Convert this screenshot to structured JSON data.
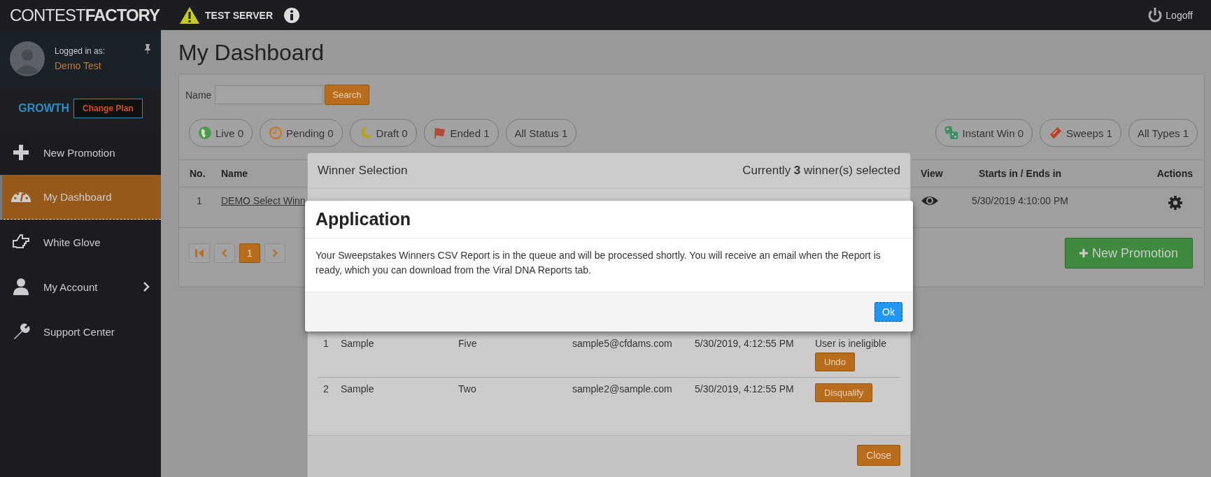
{
  "header": {
    "logo_light": "CONTEST",
    "logo_bold": "FACTORY",
    "server_label": "TEST SERVER",
    "logoff": "Logoff"
  },
  "sidebar": {
    "logged_in_label": "Logged in as:",
    "user_name": "Demo Test",
    "plan": "GROWTH",
    "change_plan": "Change Plan",
    "items": [
      {
        "label": "New Promotion",
        "selected": false,
        "expandable": false
      },
      {
        "label": "My Dashboard",
        "selected": true,
        "expandable": false
      },
      {
        "label": "White Glove",
        "selected": false,
        "expandable": false
      },
      {
        "label": "My Account",
        "selected": false,
        "expandable": true
      },
      {
        "label": "Support Center",
        "selected": false,
        "expandable": false
      }
    ]
  },
  "page": {
    "title": "My Dashboard",
    "search": {
      "label": "Name",
      "button": "Search"
    },
    "status_filters": [
      {
        "label": "Live 0"
      },
      {
        "label": "Pending 0"
      },
      {
        "label": "Draft 0"
      },
      {
        "label": "Ended 1"
      },
      {
        "label": "All Status 1"
      }
    ],
    "type_filters": [
      {
        "label": "Instant Win 0"
      },
      {
        "label": "Sweeps 1"
      },
      {
        "label": "All Types 1"
      }
    ],
    "table": {
      "columns": [
        "No.",
        "Name",
        "View",
        "Starts in / Ends in",
        "Actions"
      ],
      "rows": [
        {
          "no": "1",
          "name": "DEMO Select Winn",
          "starts": "5/30/2019 4:10:00 PM"
        }
      ]
    },
    "pagination": [
      {
        "label": "1",
        "selected": true
      }
    ],
    "new_promotion": "New Promotion"
  },
  "winner_dialog": {
    "title": "Winner Selection",
    "summary": "Currently **3** winner(s) selected",
    "rows": [
      {
        "no": "1",
        "first": "Sample",
        "last": "Five",
        "email": "sample5@cfdams.com",
        "date": "5/30/2019, 4:12:55 PM",
        "note": "User is ineligible",
        "action": "Undo"
      },
      {
        "no": "2",
        "first": "Sample",
        "last": "Two",
        "email": "sample2@sample.com",
        "date": "5/30/2019, 4:12:55 PM",
        "action": "Disqualify"
      }
    ],
    "close": "Close"
  },
  "alert_dialog": {
    "title": "Application",
    "message": "Your Sweepstakes Winners CSV Report is in the queue and will be processed shortly. You will receive an email when the Report is ready, which you can download from the Viral DNA Reports tab.",
    "ok": "Ok"
  }
}
